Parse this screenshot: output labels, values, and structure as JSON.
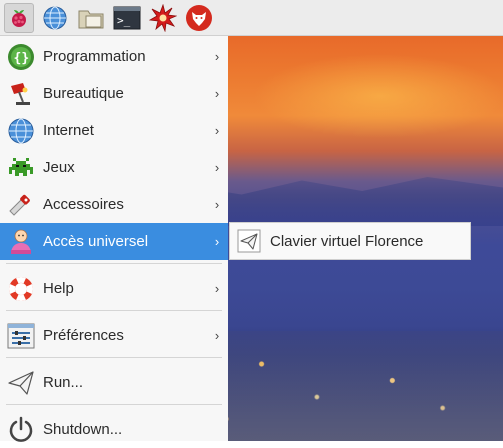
{
  "taskbar": {
    "items": [
      {
        "icon": "raspberry-menu-icon",
        "active": true
      },
      {
        "icon": "web-browser-globe-icon"
      },
      {
        "icon": "file-manager-folder-icon"
      },
      {
        "icon": "terminal-icon",
        "glyph": ">_"
      },
      {
        "icon": "mathematica-star-icon"
      },
      {
        "icon": "wolfram-wolf-icon"
      }
    ]
  },
  "menu": {
    "items": [
      {
        "label": "Programmation",
        "icon": "programming-icon",
        "has_submenu": true
      },
      {
        "label": "Bureautique",
        "icon": "office-lamp-icon",
        "has_submenu": true
      },
      {
        "label": "Internet",
        "icon": "internet-globe-icon",
        "has_submenu": true
      },
      {
        "label": "Jeux",
        "icon": "games-invader-icon",
        "has_submenu": true
      },
      {
        "label": "Accessoires",
        "icon": "accessories-knife-icon",
        "has_submenu": true
      },
      {
        "label": "Accès universel",
        "icon": "universal-access-person-icon",
        "has_submenu": true,
        "highlighted": true
      },
      {
        "label": "Help",
        "icon": "help-lifebuoy-icon",
        "has_submenu": true
      },
      {
        "label": "Préférences",
        "icon": "preferences-icon",
        "has_submenu": true
      },
      {
        "label": "Run...",
        "icon": "run-paperplane-icon",
        "has_submenu": false
      },
      {
        "label": "Shutdown...",
        "icon": "shutdown-power-icon",
        "has_submenu": false
      }
    ],
    "arrow_glyph": "›"
  },
  "submenu": {
    "items": [
      {
        "label": "Clavier virtuel Florence",
        "icon": "onscreen-keyboard-paperplane-icon"
      }
    ]
  },
  "colors": {
    "highlight": "#3a8de0",
    "menu_bg": "#f7f7f7",
    "taskbar_bg": "#ececec"
  }
}
